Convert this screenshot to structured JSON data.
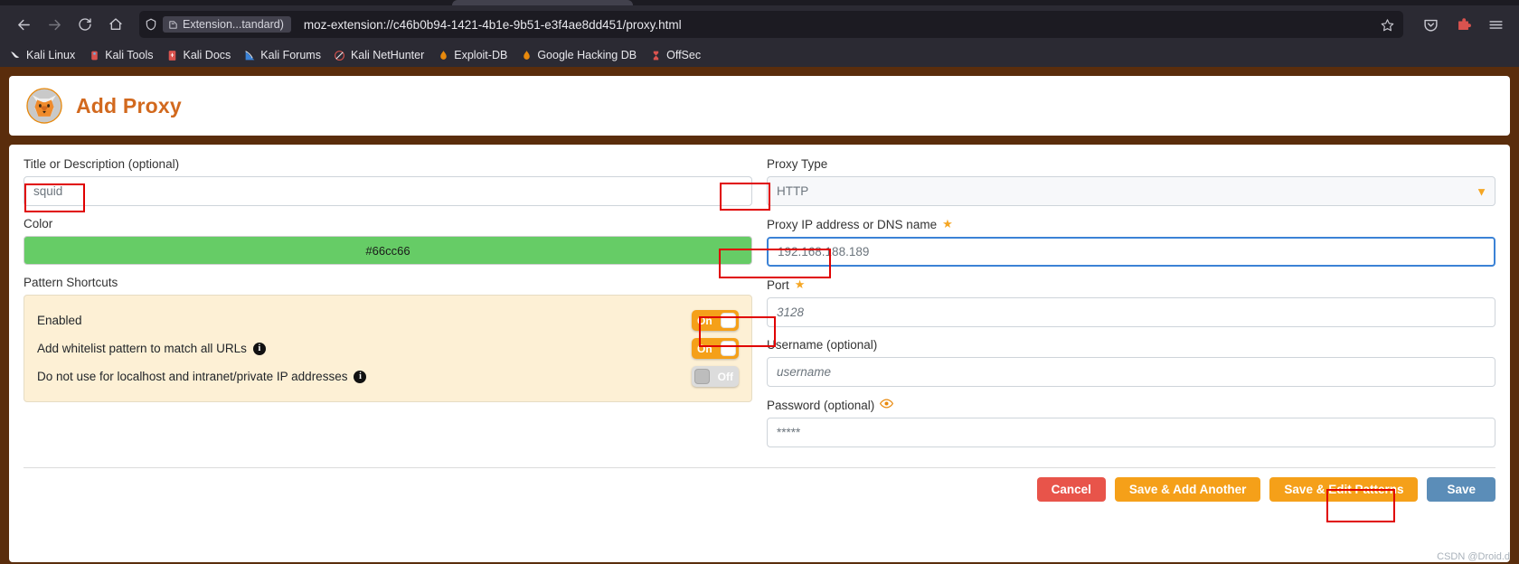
{
  "browser": {
    "back_icon": "back-arrow-icon",
    "forward_icon": "forward-arrow-icon",
    "reload_icon": "reload-icon",
    "home_icon": "home-icon",
    "shield_icon": "shield-icon",
    "extension_chip_label": "Extension...tandard)",
    "url": "moz-extension://c46b0b94-1421-4b1e-9b51-e3f4ae8dd451/proxy.html",
    "bookmark_star_icon": "star-outline-icon",
    "pocket_icon": "pocket-icon",
    "extensions_icon": "extensions-icon",
    "menu_icon": "hamburger-menu-icon",
    "bookmarks": [
      {
        "label": "Kali Linux",
        "icon": "kali-dragon-icon"
      },
      {
        "label": "Kali Tools",
        "icon": "kali-tools-icon"
      },
      {
        "label": "Kali Docs",
        "icon": "kali-docs-icon"
      },
      {
        "label": "Kali Forums",
        "icon": "kali-forums-icon"
      },
      {
        "label": "Kali NetHunter",
        "icon": "kali-nethunter-icon"
      },
      {
        "label": "Exploit-DB",
        "icon": "exploit-db-icon"
      },
      {
        "label": "Google Hacking DB",
        "icon": "google-hacking-db-icon"
      },
      {
        "label": "OffSec",
        "icon": "offsec-icon"
      }
    ]
  },
  "header": {
    "title": "Add Proxy",
    "logo_icon": "foxyproxy-fox-logo"
  },
  "form": {
    "title_label": "Title or Description (optional)",
    "title_placeholder": "squid",
    "color_label": "Color",
    "color_value": "#66cc66",
    "pattern_shortcuts_label": "Pattern Shortcuts",
    "patterns": [
      {
        "label": "Enabled",
        "has_info": false,
        "toggle": "On"
      },
      {
        "label": "Add whitelist pattern to match all URLs",
        "has_info": true,
        "toggle": "On"
      },
      {
        "label": "Do not use for localhost and intranet/private IP addresses",
        "has_info": true,
        "toggle": "Off"
      }
    ],
    "proxy_type_label": "Proxy Type",
    "proxy_type_value": "HTTP",
    "proxy_ip_label": "Proxy IP address or DNS name",
    "proxy_ip_placeholder": "192.168.188.189",
    "port_label": "Port",
    "port_placeholder": "3128",
    "username_label": "Username (optional)",
    "username_placeholder": "username",
    "password_label": "Password (optional)",
    "password_placeholder": "*****",
    "password_eye_icon": "eye-visibility-icon",
    "required_star": "★",
    "info_char": "i",
    "select_arrow": "▼"
  },
  "actions": {
    "cancel": "Cancel",
    "save_add_another": "Save & Add Another",
    "save_edit_patterns": "Save & Edit Patterns",
    "save": "Save"
  },
  "watermark": "CSDN @Droid.d",
  "colors": {
    "accent_orange": "#f5a019",
    "title_orange": "#d2691e",
    "swatch_green": "#66cc66",
    "cancel_red": "#e8544a",
    "save_blue": "#5b8db8",
    "annotation_red": "#e00000"
  }
}
